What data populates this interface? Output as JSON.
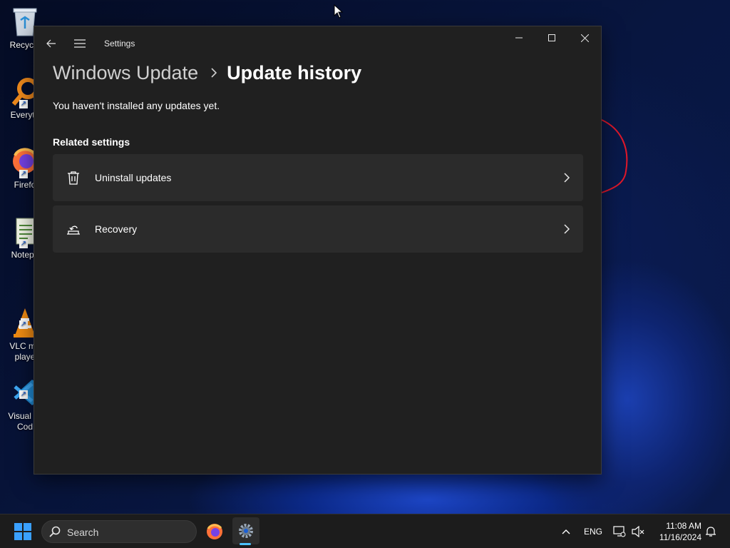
{
  "desktop": {
    "icons": [
      {
        "label": "Recycle",
        "icon": "recycle-bin-icon"
      },
      {
        "label": "Everyth",
        "icon": "everything-search-icon"
      },
      {
        "label": "Firefo",
        "icon": "firefox-icon"
      },
      {
        "label": "Notepa",
        "icon": "notepad-icon"
      },
      {
        "label": "VLC me\nplaye",
        "icon": "vlc-icon"
      },
      {
        "label": "Visual St\nCod",
        "icon": "vscode-icon"
      }
    ]
  },
  "window": {
    "app_title": "Settings",
    "breadcrumb": {
      "parent": "Windows Update",
      "current": "Update history"
    },
    "empty_message": "You haven't installed any updates yet.",
    "related_settings": {
      "title": "Related settings",
      "items": [
        {
          "label": "Uninstall updates",
          "icon": "trash-icon"
        },
        {
          "label": "Recovery",
          "icon": "recovery-icon"
        }
      ]
    }
  },
  "taskbar": {
    "search_placeholder": "Search",
    "language": "ENG",
    "time": "11:08 AM",
    "date": "11/16/2024"
  },
  "colors": {
    "window_bg": "#202020",
    "card_bg": "#2b2b2b",
    "taskbar_bg": "#1c1c1c",
    "accent": "#4cc2ff"
  }
}
